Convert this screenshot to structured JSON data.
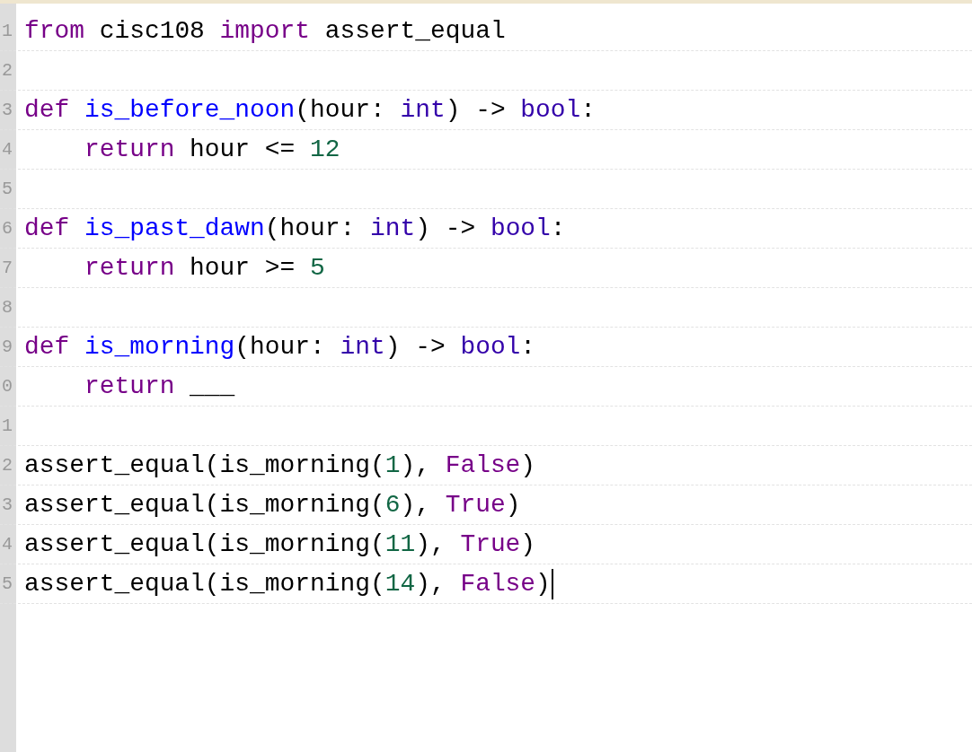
{
  "editor": {
    "lines": [
      {
        "number": "1",
        "tokens": [
          {
            "text": "from",
            "kind": "keyword"
          },
          {
            "text": " cisc108 ",
            "kind": "plain"
          },
          {
            "text": "import",
            "kind": "keyword"
          },
          {
            "text": " assert_equal",
            "kind": "plain"
          }
        ]
      },
      {
        "number": "2"
      },
      {
        "number": "3",
        "tokens": [
          {
            "text": "def ",
            "kind": "keyword"
          },
          {
            "text": "is_before_noon",
            "kind": "def"
          },
          {
            "text": "(hour: ",
            "kind": "plain"
          },
          {
            "text": "int",
            "kind": "builtin"
          },
          {
            "text": ") -> ",
            "kind": "plain"
          },
          {
            "text": "bool",
            "kind": "builtin"
          },
          {
            "text": ":",
            "kind": "plain"
          }
        ]
      },
      {
        "number": "4",
        "tokens": [
          {
            "text": "    return",
            "kind": "keyword"
          },
          {
            "text": " hour <= ",
            "kind": "plain"
          },
          {
            "text": "12",
            "kind": "number"
          }
        ]
      },
      {
        "number": "5"
      },
      {
        "number": "6",
        "tokens": [
          {
            "text": "def ",
            "kind": "keyword"
          },
          {
            "text": "is_past_dawn",
            "kind": "def"
          },
          {
            "text": "(hour: ",
            "kind": "plain"
          },
          {
            "text": "int",
            "kind": "builtin"
          },
          {
            "text": ") -> ",
            "kind": "plain"
          },
          {
            "text": "bool",
            "kind": "builtin"
          },
          {
            "text": ":",
            "kind": "plain"
          }
        ]
      },
      {
        "number": "7",
        "tokens": [
          {
            "text": "    return",
            "kind": "keyword"
          },
          {
            "text": " hour >= ",
            "kind": "plain"
          },
          {
            "text": "5",
            "kind": "number"
          }
        ]
      },
      {
        "number": "8"
      },
      {
        "number": "9",
        "tokens": [
          {
            "text": "def ",
            "kind": "keyword"
          },
          {
            "text": "is_morning",
            "kind": "def"
          },
          {
            "text": "(hour: ",
            "kind": "plain"
          },
          {
            "text": "int",
            "kind": "builtin"
          },
          {
            "text": ") -> ",
            "kind": "plain"
          },
          {
            "text": "bool",
            "kind": "builtin"
          },
          {
            "text": ":",
            "kind": "plain"
          }
        ]
      },
      {
        "number": "0",
        "tokens": [
          {
            "text": "    return",
            "kind": "keyword"
          },
          {
            "text": " ___",
            "kind": "plain"
          }
        ]
      },
      {
        "number": "1"
      },
      {
        "number": "2",
        "tokens": [
          {
            "text": "assert_equal(is_morning(",
            "kind": "plain"
          },
          {
            "text": "1",
            "kind": "number"
          },
          {
            "text": "), ",
            "kind": "plain"
          },
          {
            "text": "False",
            "kind": "keyword"
          },
          {
            "text": ")",
            "kind": "plain"
          }
        ]
      },
      {
        "number": "3",
        "tokens": [
          {
            "text": "assert_equal(is_morning(",
            "kind": "plain"
          },
          {
            "text": "6",
            "kind": "number"
          },
          {
            "text": "), ",
            "kind": "plain"
          },
          {
            "text": "True",
            "kind": "keyword"
          },
          {
            "text": ")",
            "kind": "plain"
          }
        ]
      },
      {
        "number": "4",
        "tokens": [
          {
            "text": "assert_equal(is_morning(",
            "kind": "plain"
          },
          {
            "text": "11",
            "kind": "number"
          },
          {
            "text": "), ",
            "kind": "plain"
          },
          {
            "text": "True",
            "kind": "keyword"
          },
          {
            "text": ")",
            "kind": "plain"
          }
        ]
      },
      {
        "number": "5",
        "cursor": true,
        "tokens": [
          {
            "text": "assert_equal(is_morning(",
            "kind": "plain"
          },
          {
            "text": "14",
            "kind": "number"
          },
          {
            "text": "), ",
            "kind": "plain"
          },
          {
            "text": "False",
            "kind": "keyword"
          },
          {
            "text": ")",
            "kind": "plain"
          }
        ]
      }
    ]
  }
}
